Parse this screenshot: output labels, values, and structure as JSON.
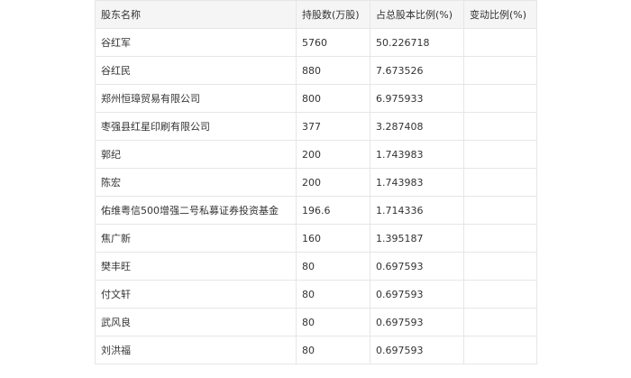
{
  "table": {
    "headers": [
      "股东名称",
      "持股数(万股)",
      "占总股本比例(%)",
      "变动比例(%)"
    ],
    "rows": [
      {
        "name": "谷红军",
        "shares": "5760",
        "ratio": "50.226718",
        "change": ""
      },
      {
        "name": "谷红民",
        "shares": "880",
        "ratio": "7.673526",
        "change": ""
      },
      {
        "name": "郑州恒璋贸易有限公司",
        "shares": "800",
        "ratio": "6.975933",
        "change": ""
      },
      {
        "name": "枣强县红星印刷有限公司",
        "shares": "377",
        "ratio": "3.287408",
        "change": ""
      },
      {
        "name": "郭纪",
        "shares": "200",
        "ratio": "1.743983",
        "change": ""
      },
      {
        "name": "陈宏",
        "shares": "200",
        "ratio": "1.743983",
        "change": ""
      },
      {
        "name": "佑维粤信500增强二号私募证券投资基金",
        "shares": "196.6",
        "ratio": "1.714336",
        "change": ""
      },
      {
        "name": "焦广新",
        "shares": "160",
        "ratio": "1.395187",
        "change": ""
      },
      {
        "name": "樊丰旺",
        "shares": "80",
        "ratio": "0.697593",
        "change": ""
      },
      {
        "name": "付文轩",
        "shares": "80",
        "ratio": "0.697593",
        "change": ""
      },
      {
        "name": "武风良",
        "shares": "80",
        "ratio": "0.697593",
        "change": ""
      },
      {
        "name": "刘洪福",
        "shares": "80",
        "ratio": "0.697593",
        "change": ""
      }
    ]
  }
}
